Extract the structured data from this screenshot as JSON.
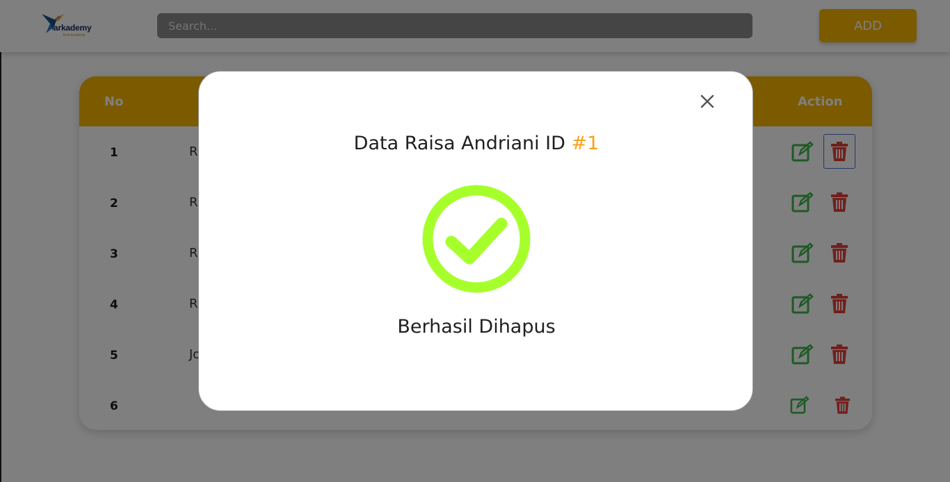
{
  "header": {
    "logo_text": "arkademy",
    "logo_sub": "Tech Academy",
    "search_placeholder": "Search...",
    "add_label": "ADD"
  },
  "table": {
    "columns": {
      "no": "No",
      "action": "Action"
    },
    "rows": [
      {
        "no": "1",
        "name_fragment": "R"
      },
      {
        "no": "2",
        "name_fragment": "R"
      },
      {
        "no": "3",
        "name_fragment": "R"
      },
      {
        "no": "4",
        "name_fragment": "R"
      },
      {
        "no": "5",
        "name_fragment": "Jo"
      },
      {
        "no": "6",
        "name_fragment": ""
      }
    ]
  },
  "modal": {
    "title_prefix": "Data Raisa Andriani ID ",
    "title_id": "#1",
    "message": "Berhasil Dihapus"
  },
  "colors": {
    "accent": "#f7b400",
    "edit": "#3cb54a",
    "delete": "#e0413a",
    "success": "#a6ff2b",
    "id_highlight": "#f7a11a"
  },
  "icons": {
    "edit": "edit-icon",
    "delete": "trash-icon",
    "close": "close-icon",
    "success": "check-circle-icon"
  }
}
